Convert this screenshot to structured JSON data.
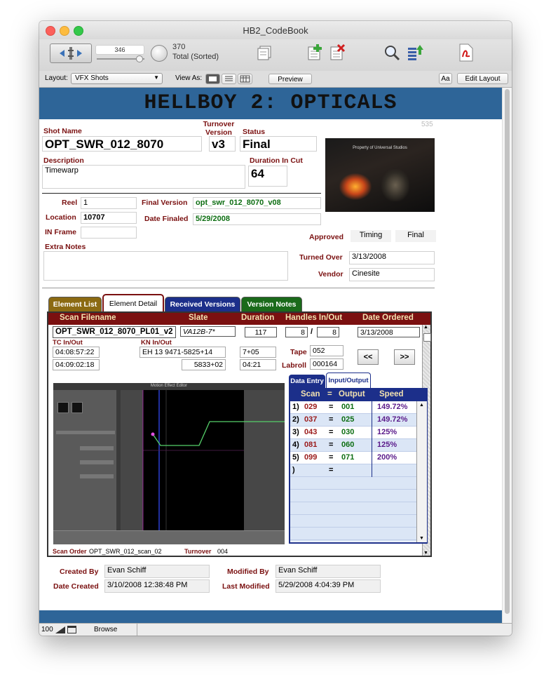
{
  "window": {
    "title": "HB2_CodeBook"
  },
  "toolbar": {
    "record_number": "346",
    "total_count": "370",
    "total_label": "Total (Sorted)"
  },
  "layoutbar": {
    "layout_label": "Layout:",
    "layout_value": "VFX Shots",
    "view_as_label": "View As:",
    "preview_label": "Preview",
    "aa_label": "Aa",
    "edit_layout_label": "Edit Layout"
  },
  "banner": {
    "title": "HELLBOY 2: OPTICALS",
    "record_id": "535"
  },
  "shot": {
    "shot_name_label": "Shot Name",
    "shot_name": "OPT_SWR_012_8070",
    "turnover_label": "Turnover Version",
    "turnover": "v3",
    "status_label": "Status",
    "status": "Final",
    "description_label": "Description",
    "description": "Timewarp",
    "duration_cut_label": "Duration In Cut",
    "duration_cut": "64",
    "reel_label": "Reel",
    "reel": "1",
    "location_label": "Location",
    "location": "10707",
    "in_frame_label": "IN Frame",
    "in_frame": "",
    "final_version_label": "Final Version",
    "final_version": "opt_swr_012_8070_v08",
    "date_finaled_label": "Date Finaled",
    "date_finaled": "5/29/2008",
    "approved_label": "Approved",
    "timing": "Timing",
    "final": "Final",
    "extra_notes_label": "Extra Notes",
    "extra_notes": "",
    "turned_over_label": "Turned Over",
    "turned_over": "3/13/2008",
    "vendor_label": "Vendor",
    "vendor": "Cinesite",
    "thumb_caption": "Property of Universal Studios"
  },
  "tabs": [
    {
      "label": "Element List",
      "color": "#8b6a12"
    },
    {
      "label": "Element Detail",
      "color": "#ffffff"
    },
    {
      "label": "Received Versions",
      "color": "#1c2f8a"
    },
    {
      "label": "Version Notes",
      "color": "#1a6a1a"
    }
  ],
  "element": {
    "headers": [
      "Scan Filename",
      "Slate",
      "Duration",
      "Handles In/Out",
      "Date Ordered"
    ],
    "scan_filename": "OPT_SWR_012_8070_PL01_v2",
    "slate": "VA12B-7*",
    "duration": "117",
    "handle_in": "8",
    "handle_sep": "/",
    "handle_out": "8",
    "date_ordered": "3/13/2008",
    "tc_label": "TC In/Out",
    "tc_in": "04:08:57:22",
    "tc_out": "04:09:02:18",
    "kn_label": "KN In/Out",
    "kn_in": "EH 13 9471-5825+14",
    "kn_out": "5833+02",
    "kn_dur_in": "7+05",
    "kn_dur_out": "04:21",
    "tape_label": "Tape",
    "tape": "052",
    "labroll_label": "Labroll",
    "labroll": "000164",
    "prev_label": "<<",
    "next_label": ">>",
    "scan_order_label": "Scan Order",
    "scan_order": "OPT_SWR_012_scan_02",
    "turnover_label": "Turnover",
    "turnover": "004",
    "editor_title": "Motion Effect Editor"
  },
  "io": {
    "tabs": [
      "Data Entry",
      "Input/Output"
    ],
    "headers": [
      "Scan",
      "=",
      "Output",
      "Speed"
    ],
    "rows": [
      {
        "n": "1)",
        "scan": "029",
        "eq": "=",
        "out": "001",
        "speed": "149.72%"
      },
      {
        "n": "2)",
        "scan": "037",
        "eq": "=",
        "out": "025",
        "speed": "149.72%"
      },
      {
        "n": "3)",
        "scan": "043",
        "eq": "=",
        "out": "030",
        "speed": "125%"
      },
      {
        "n": "4)",
        "scan": "081",
        "eq": "=",
        "out": "060",
        "speed": "125%"
      },
      {
        "n": "5)",
        "scan": "099",
        "eq": "=",
        "out": "071",
        "speed": "200%"
      },
      {
        "n": ")",
        "scan": "",
        "eq": "=",
        "out": "",
        "speed": ""
      }
    ]
  },
  "footer": {
    "created_by_label": "Created By",
    "created_by": "Evan Schiff",
    "date_created_label": "Date Created",
    "date_created": "3/10/2008 12:38:48 PM",
    "modified_by_label": "Modified By",
    "modified_by": "Evan Schiff",
    "last_modified_label": "Last Modified",
    "last_modified": "5/29/2008 4:04:39 PM"
  },
  "statusbar": {
    "zoom": "100",
    "mode": "Browse"
  }
}
